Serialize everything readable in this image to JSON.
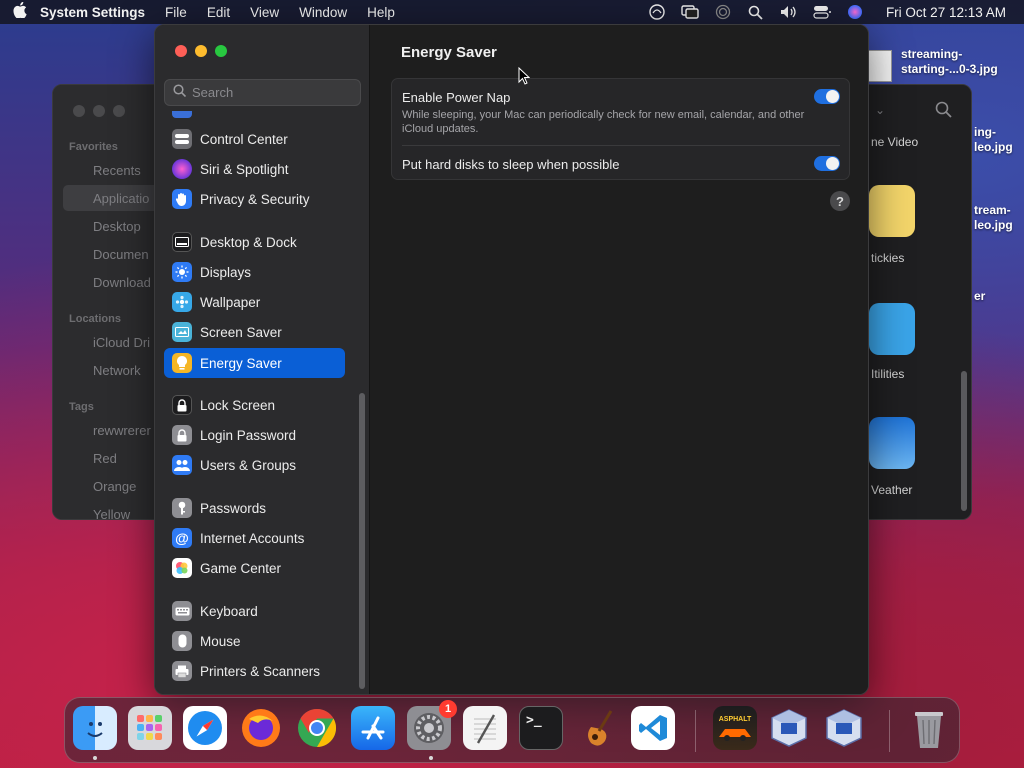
{
  "menubar": {
    "app_name": "System Settings",
    "menus": [
      "File",
      "Edit",
      "View",
      "Window",
      "Help"
    ],
    "clock": "Fri Oct 27  12:13 AM"
  },
  "finder": {
    "sections": {
      "favorites": "Favorites",
      "locations": "Locations",
      "tags": "Tags"
    },
    "favorites": [
      "Recents",
      "Applicatio",
      "Desktop",
      "Documen",
      "Download"
    ],
    "locations": [
      "iCloud Dri",
      "Network"
    ],
    "tags": [
      "rewwrerer",
      "Red",
      "Orange",
      "Yellow"
    ],
    "apps": [
      "ne Video",
      "tickies",
      "Itilities",
      "Veather"
    ]
  },
  "desktop_files": {
    "file1_line1": "streaming-",
    "file1_line2": "starting-...0-3.jpg",
    "file2_line1": "ing-",
    "file2_line2": "leo.jpg",
    "file3_line1": "tream-",
    "file3_line2": "leo.jpg",
    "file4_line1": "er"
  },
  "settings": {
    "search_placeholder": "Search",
    "sidebar": [
      {
        "label": "Control Center",
        "icon": "control-center-icon",
        "color": "#6e6e73"
      },
      {
        "label": "Siri & Spotlight",
        "icon": "siri-icon",
        "color": "#b23cc8"
      },
      {
        "label": "Privacy & Security",
        "icon": "hand-icon",
        "color": "#2f7bf5"
      },
      {
        "label": "Desktop & Dock",
        "icon": "dock-icon",
        "color": "#1c1c1e"
      },
      {
        "label": "Displays",
        "icon": "sun-icon",
        "color": "#2f7bf5"
      },
      {
        "label": "Wallpaper",
        "icon": "wallpaper-icon",
        "color": "#37a8e8"
      },
      {
        "label": "Screen Saver",
        "icon": "screen-saver-icon",
        "color": "#4ab3d8"
      },
      {
        "label": "Energy Saver",
        "icon": "lightbulb-icon",
        "color": "#f5b625",
        "selected": true
      },
      {
        "label": "Lock Screen",
        "icon": "lock-icon",
        "color": "#1c1c1e"
      },
      {
        "label": "Login Password",
        "icon": "login-lock-icon",
        "color": "#8e8e93"
      },
      {
        "label": "Users & Groups",
        "icon": "users-icon",
        "color": "#2f7bf5"
      },
      {
        "label": "Passwords",
        "icon": "key-icon",
        "color": "#8e8e93"
      },
      {
        "label": "Internet Accounts",
        "icon": "at-icon",
        "color": "#2f7bf5"
      },
      {
        "label": "Game Center",
        "icon": "game-center-icon",
        "color": "#ffffff"
      },
      {
        "label": "Keyboard",
        "icon": "keyboard-icon",
        "color": "#8e8e93"
      },
      {
        "label": "Mouse",
        "icon": "mouse-icon",
        "color": "#8e8e93"
      },
      {
        "label": "Printers & Scanners",
        "icon": "printer-icon",
        "color": "#8e8e93"
      }
    ],
    "content": {
      "title": "Energy Saver",
      "power_nap_title": "Enable Power Nap",
      "power_nap_desc": "While sleeping, your Mac can periodically check for new email, calendar, and other iCloud updates.",
      "power_nap_on": true,
      "disk_sleep_title": "Put hard disks to sleep when possible",
      "disk_sleep_on": true,
      "help": "?"
    }
  },
  "dock": {
    "settings_badge": "1",
    "apps": [
      "Finder",
      "Launchpad",
      "Safari",
      "Firefox",
      "Chrome",
      "App Store",
      "System Settings",
      "TextEdit",
      "Terminal",
      "GarageBand",
      "VS Code",
      "Asphalt",
      "VirtualBox",
      "VirtualBox",
      "Trash"
    ],
    "asphalt_label": "ASPHALT",
    "terminal_prompt": ">_"
  }
}
